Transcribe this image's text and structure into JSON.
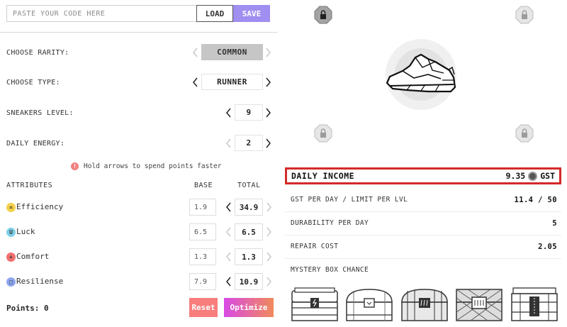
{
  "code_bar": {
    "placeholder": "PASTE YOUR CODE HERE",
    "value": "",
    "load_label": "LOAD",
    "save_label": "SAVE"
  },
  "settings": {
    "rarity": {
      "label": "CHOOSE RARITY:",
      "value": "COMMON"
    },
    "type": {
      "label": "CHOOSE TYPE:",
      "value": "RUNNER"
    },
    "level": {
      "label": "SNEAKERS LEVEL:",
      "value": "9"
    },
    "energy": {
      "label": "DAILY ENERGY:",
      "value": "2"
    }
  },
  "hint": {
    "icon": "!",
    "text": "Hold arrows to spend points faster"
  },
  "attributes": {
    "header": {
      "name": "ATTRIBUTES",
      "base": "BASE",
      "total": "TOTAL"
    },
    "rows": [
      {
        "name": "Efficiency",
        "icon": "efficiency-icon",
        "glyph": "≈",
        "color": "#f2d04b",
        "base": "1.9",
        "total": "34.9"
      },
      {
        "name": "Luck",
        "icon": "luck-icon",
        "glyph": "U",
        "color": "#7fd0e8",
        "base": "6.5",
        "total": "6.5"
      },
      {
        "name": "Comfort",
        "icon": "comfort-icon",
        "glyph": "+",
        "color": "#f07070",
        "base": "1.3",
        "total": "1.3"
      },
      {
        "name": "Resiliense",
        "icon": "resilience-icon",
        "glyph": "□",
        "color": "#8ea6f0",
        "base": "7.9",
        "total": "10.9"
      }
    ]
  },
  "points": "Points: 0",
  "buttons": {
    "reset": "Reset",
    "optimize": "Optimize"
  },
  "income": {
    "label": "DAILY INCOME",
    "value": "9.35",
    "currency": "GST",
    "highlight_color": "#d32a2a"
  },
  "stats": [
    {
      "label": "GST PER DAY / LIMIT PER LVL",
      "value": "11.4 / 50"
    },
    {
      "label": "DURABILITY PER DAY",
      "value": "5"
    },
    {
      "label": "REPAIR COST",
      "value": "2.05"
    }
  ],
  "mystery_box": {
    "label": "MYSTERY BOX CHANCE"
  },
  "colors": {
    "save": "#a08ef0",
    "reset": "#f87d7d",
    "optimize_start": "#d84ae6",
    "optimize_end": "#f08a5a"
  }
}
